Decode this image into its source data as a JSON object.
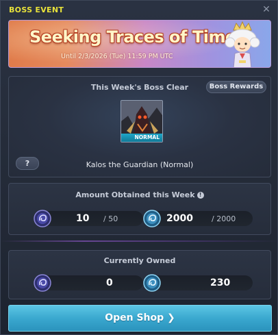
{
  "window": {
    "title": "BOSS EVENT"
  },
  "banner": {
    "title": "Seeking Traces of Time",
    "subtitle": "Until 2/3/2026 (Tue) 11:59 PM UTC"
  },
  "boss": {
    "heading": "This Week's Boss Clear",
    "rewards_button": "Boss Rewards",
    "difficulty": "NORMAL",
    "name": "Kalos the Guardian (Normal)",
    "help_button": "?"
  },
  "weekly": {
    "heading": "Amount Obtained this Week",
    "coin_a": {
      "value": "10",
      "max": "/ 50",
      "icon": "purple-swirl-coin-icon"
    },
    "coin_b": {
      "value": "2000",
      "max": "/ 2000",
      "icon": "blue-swirl-coin-icon"
    }
  },
  "owned": {
    "heading": "Currently Owned",
    "coin_a": {
      "value": "0",
      "icon": "purple-swirl-coin-icon"
    },
    "coin_b": {
      "value": "230",
      "icon": "blue-swirl-coin-icon"
    }
  },
  "shop_button": "Open Shop ❯",
  "colors": {
    "title": "#e8e23a",
    "shop_button": "#3aa8cf",
    "difficulty_badge": "#1fa7c9"
  }
}
